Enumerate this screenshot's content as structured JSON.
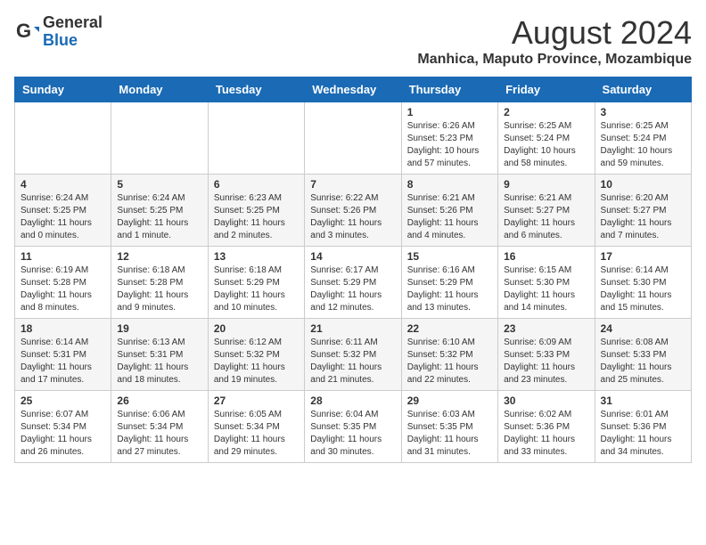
{
  "header": {
    "logo_general": "General",
    "logo_blue": "Blue",
    "main_title": "August 2024",
    "subtitle": "Manhica, Maputo Province, Mozambique"
  },
  "weekdays": [
    "Sunday",
    "Monday",
    "Tuesday",
    "Wednesday",
    "Thursday",
    "Friday",
    "Saturday"
  ],
  "weeks": [
    [
      {
        "day": "",
        "info": ""
      },
      {
        "day": "",
        "info": ""
      },
      {
        "day": "",
        "info": ""
      },
      {
        "day": "",
        "info": ""
      },
      {
        "day": "1",
        "info": "Sunrise: 6:26 AM\nSunset: 5:23 PM\nDaylight: 10 hours and 57 minutes."
      },
      {
        "day": "2",
        "info": "Sunrise: 6:25 AM\nSunset: 5:24 PM\nDaylight: 10 hours and 58 minutes."
      },
      {
        "day": "3",
        "info": "Sunrise: 6:25 AM\nSunset: 5:24 PM\nDaylight: 10 hours and 59 minutes."
      }
    ],
    [
      {
        "day": "4",
        "info": "Sunrise: 6:24 AM\nSunset: 5:25 PM\nDaylight: 11 hours and 0 minutes."
      },
      {
        "day": "5",
        "info": "Sunrise: 6:24 AM\nSunset: 5:25 PM\nDaylight: 11 hours and 1 minute."
      },
      {
        "day": "6",
        "info": "Sunrise: 6:23 AM\nSunset: 5:25 PM\nDaylight: 11 hours and 2 minutes."
      },
      {
        "day": "7",
        "info": "Sunrise: 6:22 AM\nSunset: 5:26 PM\nDaylight: 11 hours and 3 minutes."
      },
      {
        "day": "8",
        "info": "Sunrise: 6:21 AM\nSunset: 5:26 PM\nDaylight: 11 hours and 4 minutes."
      },
      {
        "day": "9",
        "info": "Sunrise: 6:21 AM\nSunset: 5:27 PM\nDaylight: 11 hours and 6 minutes."
      },
      {
        "day": "10",
        "info": "Sunrise: 6:20 AM\nSunset: 5:27 PM\nDaylight: 11 hours and 7 minutes."
      }
    ],
    [
      {
        "day": "11",
        "info": "Sunrise: 6:19 AM\nSunset: 5:28 PM\nDaylight: 11 hours and 8 minutes."
      },
      {
        "day": "12",
        "info": "Sunrise: 6:18 AM\nSunset: 5:28 PM\nDaylight: 11 hours and 9 minutes."
      },
      {
        "day": "13",
        "info": "Sunrise: 6:18 AM\nSunset: 5:29 PM\nDaylight: 11 hours and 10 minutes."
      },
      {
        "day": "14",
        "info": "Sunrise: 6:17 AM\nSunset: 5:29 PM\nDaylight: 11 hours and 12 minutes."
      },
      {
        "day": "15",
        "info": "Sunrise: 6:16 AM\nSunset: 5:29 PM\nDaylight: 11 hours and 13 minutes."
      },
      {
        "day": "16",
        "info": "Sunrise: 6:15 AM\nSunset: 5:30 PM\nDaylight: 11 hours and 14 minutes."
      },
      {
        "day": "17",
        "info": "Sunrise: 6:14 AM\nSunset: 5:30 PM\nDaylight: 11 hours and 15 minutes."
      }
    ],
    [
      {
        "day": "18",
        "info": "Sunrise: 6:14 AM\nSunset: 5:31 PM\nDaylight: 11 hours and 17 minutes."
      },
      {
        "day": "19",
        "info": "Sunrise: 6:13 AM\nSunset: 5:31 PM\nDaylight: 11 hours and 18 minutes."
      },
      {
        "day": "20",
        "info": "Sunrise: 6:12 AM\nSunset: 5:32 PM\nDaylight: 11 hours and 19 minutes."
      },
      {
        "day": "21",
        "info": "Sunrise: 6:11 AM\nSunset: 5:32 PM\nDaylight: 11 hours and 21 minutes."
      },
      {
        "day": "22",
        "info": "Sunrise: 6:10 AM\nSunset: 5:32 PM\nDaylight: 11 hours and 22 minutes."
      },
      {
        "day": "23",
        "info": "Sunrise: 6:09 AM\nSunset: 5:33 PM\nDaylight: 11 hours and 23 minutes."
      },
      {
        "day": "24",
        "info": "Sunrise: 6:08 AM\nSunset: 5:33 PM\nDaylight: 11 hours and 25 minutes."
      }
    ],
    [
      {
        "day": "25",
        "info": "Sunrise: 6:07 AM\nSunset: 5:34 PM\nDaylight: 11 hours and 26 minutes."
      },
      {
        "day": "26",
        "info": "Sunrise: 6:06 AM\nSunset: 5:34 PM\nDaylight: 11 hours and 27 minutes."
      },
      {
        "day": "27",
        "info": "Sunrise: 6:05 AM\nSunset: 5:34 PM\nDaylight: 11 hours and 29 minutes."
      },
      {
        "day": "28",
        "info": "Sunrise: 6:04 AM\nSunset: 5:35 PM\nDaylight: 11 hours and 30 minutes."
      },
      {
        "day": "29",
        "info": "Sunrise: 6:03 AM\nSunset: 5:35 PM\nDaylight: 11 hours and 31 minutes."
      },
      {
        "day": "30",
        "info": "Sunrise: 6:02 AM\nSunset: 5:36 PM\nDaylight: 11 hours and 33 minutes."
      },
      {
        "day": "31",
        "info": "Sunrise: 6:01 AM\nSunset: 5:36 PM\nDaylight: 11 hours and 34 minutes."
      }
    ]
  ]
}
